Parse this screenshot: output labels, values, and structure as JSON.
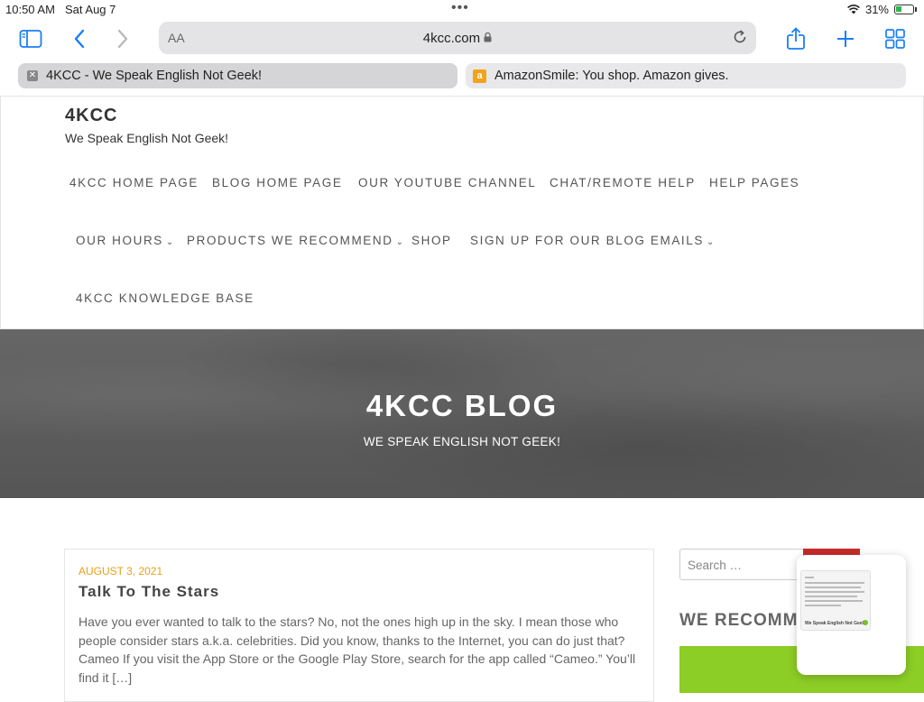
{
  "status_bar": {
    "time": "10:50 AM",
    "date": "Sat Aug 7",
    "battery_percent": "31%",
    "battery_level": 0.31
  },
  "toolbar": {
    "text_size_label": "AA",
    "url": "4kcc.com",
    "icons": [
      "sidebar-icon",
      "back-icon",
      "forward-icon",
      "lock-icon",
      "reload-icon",
      "share-icon",
      "new-tab-icon",
      "tab-overview-icon"
    ],
    "accent_color": "#1a7ef5"
  },
  "tabs": [
    {
      "title": "4KCC - We Speak English Not Geek!",
      "active": true
    },
    {
      "title": "AmazonSmile: You shop. Amazon gives.",
      "active": false
    }
  ],
  "site": {
    "title": "4KCC",
    "tagline": "We Speak English Not Geek!",
    "nav": [
      {
        "label": "4KCC HOME PAGE",
        "has_dropdown": false
      },
      {
        "label": "BLOG HOME PAGE",
        "has_dropdown": false
      },
      {
        "label": "OUR YOUTUBE CHANNEL",
        "has_dropdown": false
      },
      {
        "label": "CHAT/REMOTE HELP",
        "has_dropdown": false
      },
      {
        "label": "HELP PAGES",
        "has_dropdown": false
      },
      {
        "label": "OUR HOURS",
        "has_dropdown": true
      },
      {
        "label": "PRODUCTS WE RECOMMEND",
        "has_dropdown": true
      },
      {
        "label": "SHOP",
        "has_dropdown": false
      },
      {
        "label": "SIGN UP FOR OUR BLOG EMAILS",
        "has_dropdown": true
      },
      {
        "label": "4KCC KNOWLEDGE BASE",
        "has_dropdown": false
      }
    ]
  },
  "hero": {
    "title": "4KCC BLOG",
    "subtitle": "WE SPEAK ENGLISH NOT GEEK!"
  },
  "post": {
    "date": "AUGUST 3, 2021",
    "title": "Talk To The Stars",
    "excerpt": "Have you ever wanted to talk to the stars? No, not the ones high up in the sky. I mean those who people consider stars a.k.a. celebrities. Did you know, thanks to the Internet, you can do just that? Cameo If you visit the App Store or the Google Play Store, search for the app called “Cameo.” You’ll find it […]",
    "date_color": "#e7a117"
  },
  "sidebar": {
    "search_placeholder": "Search …",
    "widget_title": "WE RECOMM",
    "search_button_color": "#c82a2a",
    "promo_color": "#8ccd26"
  },
  "popup": {
    "thumb_title": "We Speak English Not Geek!"
  }
}
